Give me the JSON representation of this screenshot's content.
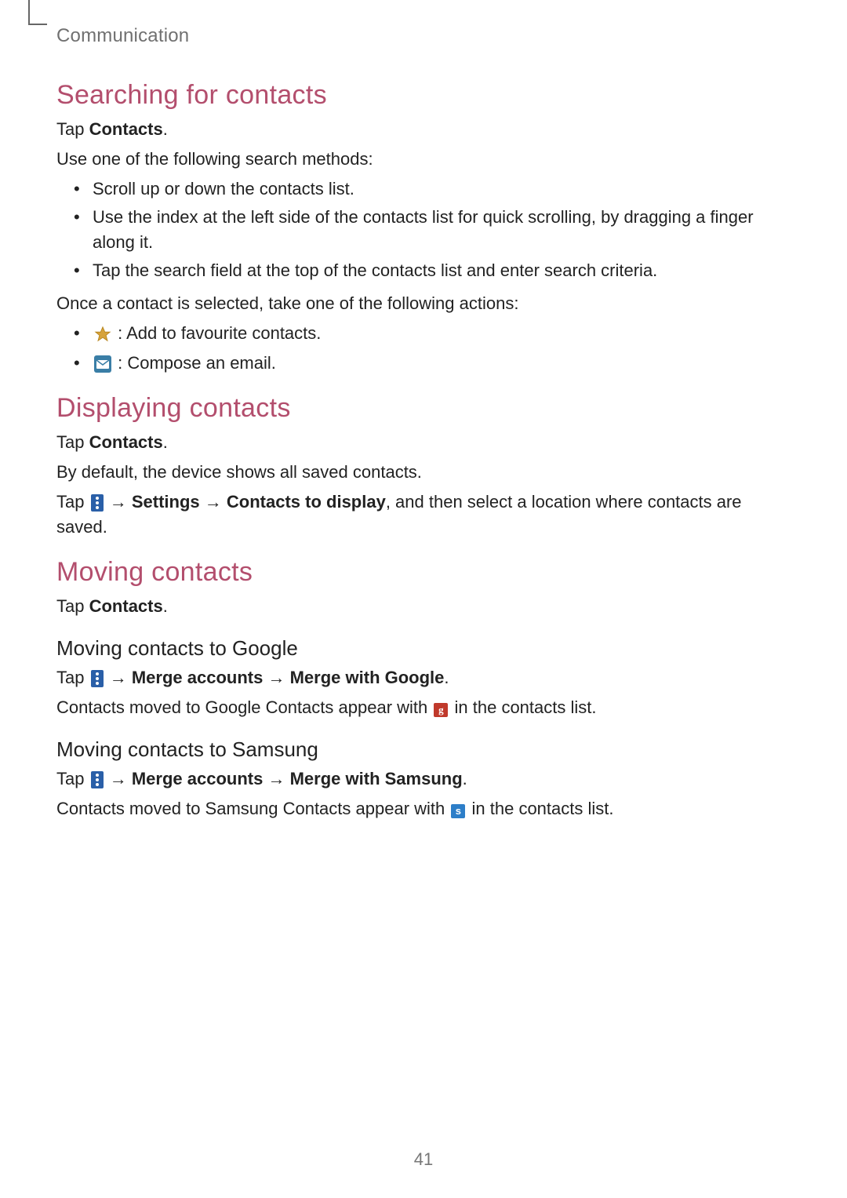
{
  "chapter": "Communication",
  "page_number": "41",
  "sections": {
    "searching": {
      "heading": "Searching for contacts",
      "tap_contacts_prefix": "Tap",
      "tap_contacts_bold": "Contacts",
      "tap_contacts_suffix": ".",
      "intro": "Use one of the following search methods:",
      "methods": [
        "Scroll up or down the contacts list.",
        "Use the index at the left side of the contacts list for quick scrolling, by dragging a finger along it.",
        "Tap the search field at the top of the contacts list and enter search criteria."
      ],
      "once_selected": "Once a contact is selected, take one of the following actions:",
      "actions": {
        "star": ": Add to favourite contacts.",
        "mail": ": Compose an email."
      }
    },
    "displaying": {
      "heading": "Displaying contacts",
      "tap_contacts_prefix": "Tap",
      "tap_contacts_bold": "Contacts",
      "tap_contacts_suffix": ".",
      "default_text": "By default, the device shows all saved contacts.",
      "path": {
        "prefix": "Tap",
        "arrow": "→",
        "settings": "Settings",
        "contacts_to_display": "Contacts to display",
        "suffix": ", and then select a location where contacts are saved."
      }
    },
    "moving": {
      "heading": "Moving contacts",
      "tap_contacts_prefix": "Tap",
      "tap_contacts_bold": "Contacts",
      "tap_contacts_suffix": ".",
      "google": {
        "subheading": "Moving contacts to Google",
        "path": {
          "prefix": "Tap",
          "arrow": "→",
          "merge_accounts": "Merge accounts",
          "merge_with": "Merge with Google",
          "suffix": "."
        },
        "result_prefix": "Contacts moved to Google Contacts appear with",
        "result_suffix": "in the contacts list."
      },
      "samsung": {
        "subheading": "Moving contacts to Samsung",
        "path": {
          "prefix": "Tap",
          "arrow": "→",
          "merge_accounts": "Merge accounts",
          "merge_with": "Merge with Samsung",
          "suffix": "."
        },
        "result_prefix": "Contacts moved to Samsung Contacts appear with",
        "result_suffix": "in the contacts list."
      }
    }
  }
}
